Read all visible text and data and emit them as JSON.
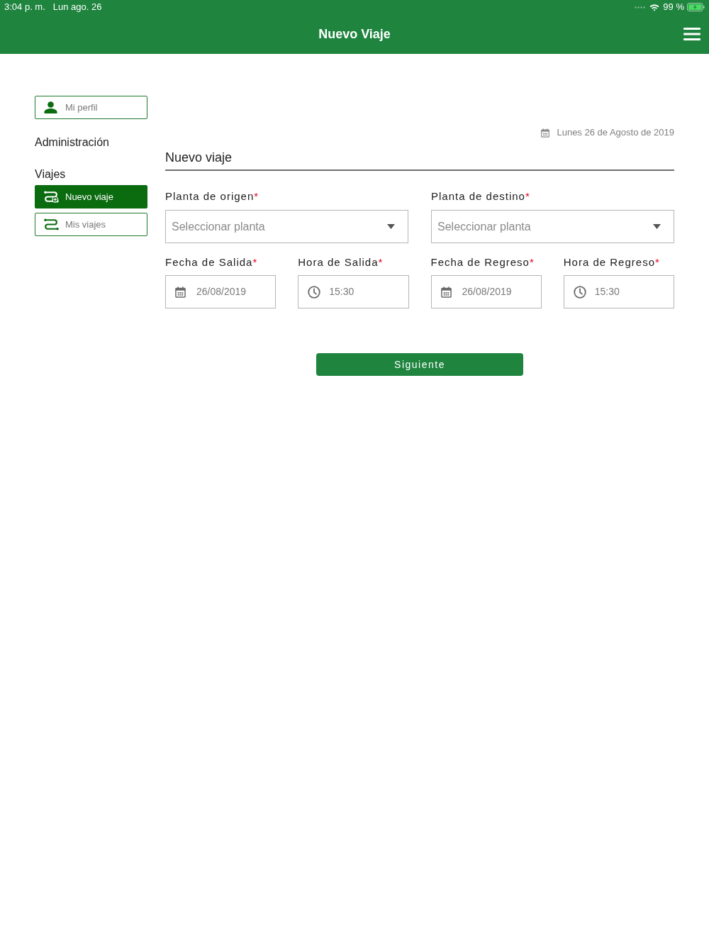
{
  "status_bar": {
    "time": "3:04 p. m.",
    "date": "Lun ago. 26",
    "battery": "99 %"
  },
  "header": {
    "title": "Nuevo Viaje"
  },
  "sidebar": {
    "profile": {
      "label": "Mi perfil"
    },
    "sections": [
      {
        "title": "Administración"
      },
      {
        "title": "Viajes",
        "items": [
          {
            "label": "Nuevo viaje",
            "selected": true
          },
          {
            "label": "Mis viajes",
            "selected": false
          }
        ]
      }
    ]
  },
  "date_line": "Lunes 26 de Agosto de 2019",
  "form": {
    "title": "Nuevo viaje",
    "selects": [
      {
        "label": "Planta de origen",
        "required_mark": "*",
        "placeholder": "Seleccionar planta"
      },
      {
        "label": "Planta de destino",
        "required_mark": "*",
        "placeholder": "Seleccionar planta"
      }
    ],
    "fields": [
      {
        "kind": "date",
        "label": "Fecha de Salida",
        "required_mark": "*",
        "value": "26/08/2019"
      },
      {
        "kind": "time",
        "label": "Hora de Salida",
        "required_mark": "*",
        "value": "15:30"
      },
      {
        "kind": "date",
        "label": "Fecha de Regreso",
        "required_mark": "*",
        "value": "26/08/2019"
      },
      {
        "kind": "time",
        "label": "Hora de Regreso",
        "required_mark": "*",
        "value": "15:30"
      }
    ],
    "submit": "Siguiente"
  }
}
